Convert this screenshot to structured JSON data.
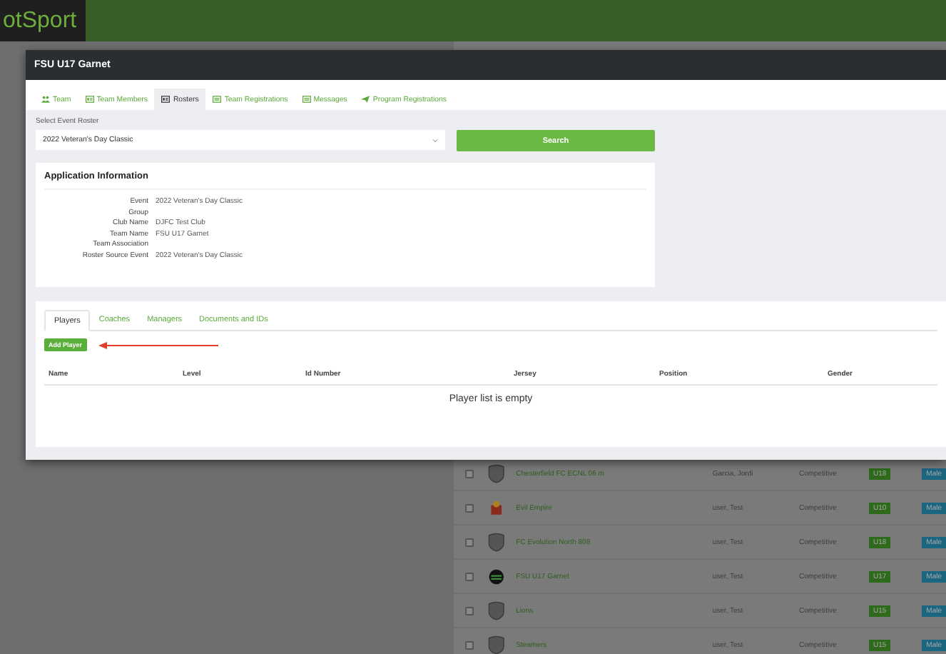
{
  "header": {
    "logo": "otSport"
  },
  "modal": {
    "title": "FSU U17 Garnet",
    "tabs": [
      {
        "label": "Team",
        "kind": "people",
        "selected": false
      },
      {
        "label": "Team Members",
        "kind": "card",
        "selected": false
      },
      {
        "label": "Rosters",
        "kind": "card",
        "selected": true
      },
      {
        "label": "Team Registrations",
        "kind": "list",
        "selected": false
      },
      {
        "label": "Messages",
        "kind": "list",
        "selected": false
      },
      {
        "label": "Program Registrations",
        "kind": "send",
        "selected": false
      }
    ],
    "roster_select": {
      "label": "Select Event Roster",
      "value": "2022 Veteran's Day Classic"
    },
    "search_button": "Search",
    "application_info": {
      "title": "Application Information",
      "fields": [
        {
          "label": "Event",
          "value": "2022 Veteran's Day Classic"
        },
        {
          "label": "Group"
        },
        {
          "label": "Club Name",
          "value": "DJFC Test Club"
        },
        {
          "label": "Team Name",
          "value": "FSU U17 Garnet"
        },
        {
          "label": "Team Association"
        },
        {
          "label": "Roster Source Event",
          "value": "2022 Veteran's Day Classic"
        }
      ]
    },
    "roster_tabs": [
      {
        "label": "Players",
        "selected": true
      },
      {
        "label": "Coaches",
        "selected": false
      },
      {
        "label": "Managers",
        "selected": false
      },
      {
        "label": "Documents and IDs",
        "selected": false
      }
    ],
    "add_button": "Add Player",
    "table": {
      "columns": [
        "Name",
        "Level",
        "Id Number",
        "Jersey",
        "Position",
        "Gender"
      ],
      "empty": "Player list is empty"
    }
  },
  "background_rows": [
    {
      "kind": "shield",
      "checked": false,
      "name": "Chesterfield FC ECNL 06 m",
      "user": "Garcia, Jordi",
      "level": "Competitive",
      "age": "U18",
      "gender": "Male"
    },
    {
      "kind": "emblem",
      "checked": false,
      "name": "Evil Empire",
      "user": "user, Test",
      "level": "Competitive",
      "age": "U10",
      "gender": "Male"
    },
    {
      "kind": "shield",
      "checked": false,
      "name": "FC Evolution North 808",
      "user": "user, Test",
      "level": "Competitive",
      "age": "U18",
      "gender": "Male"
    },
    {
      "kind": "circle",
      "checked": false,
      "name": "FSU U17 Garnet",
      "user": "user, Test",
      "level": "Competitive",
      "age": "U17",
      "gender": "Male"
    },
    {
      "kind": "shield",
      "checked": false,
      "name": "Lions",
      "user": "user, Test",
      "level": "Competitive",
      "age": "U15",
      "gender": "Male"
    },
    {
      "kind": "shield",
      "checked": false,
      "name": "Steamers",
      "user": "user, Test",
      "level": "Competitive",
      "age": "U15",
      "gender": "Male"
    }
  ]
}
